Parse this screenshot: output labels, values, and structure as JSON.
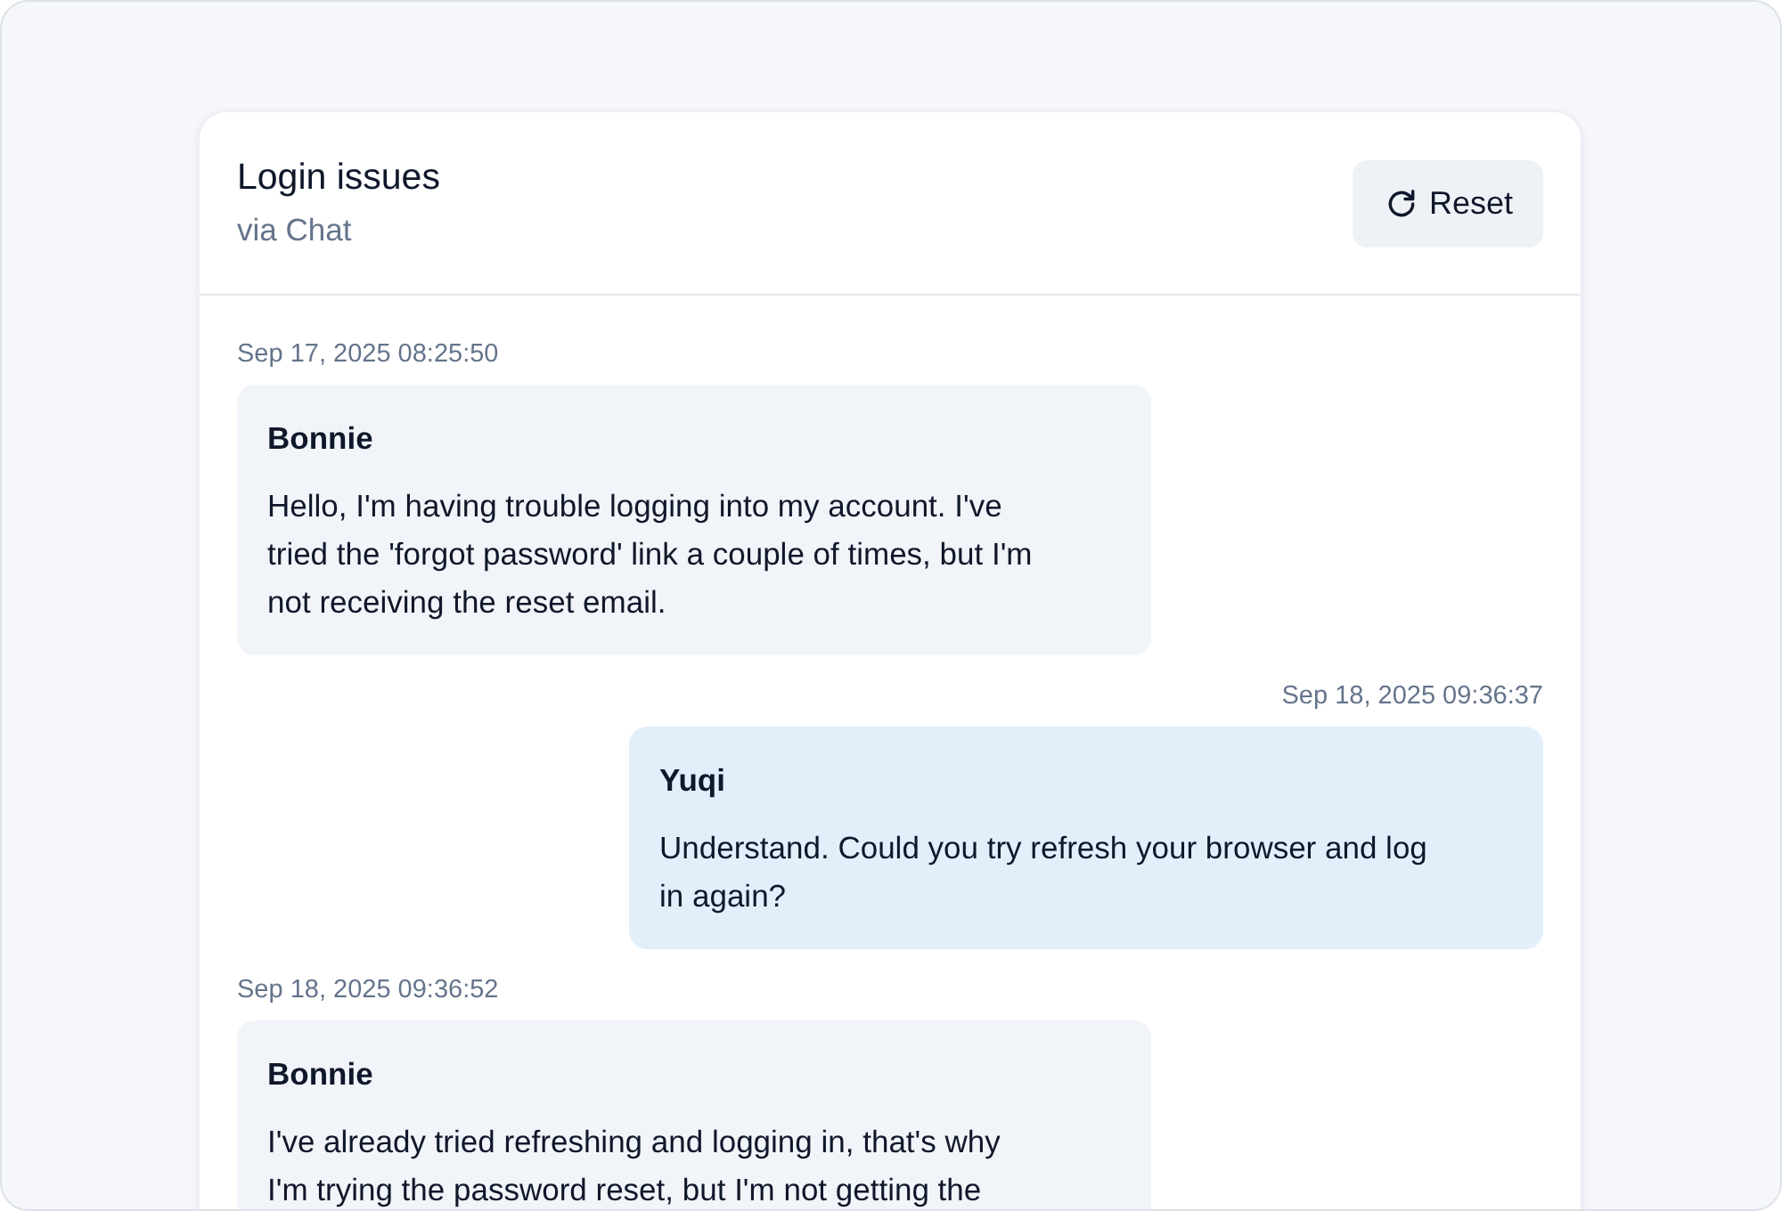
{
  "conversation": {
    "title": "Login issues",
    "channel": "via Chat"
  },
  "reset_button": {
    "label": "Reset"
  },
  "messages": [
    {
      "timestamp": "Sep 17, 2025 08:25:50",
      "sender": "Bonnie",
      "kind": "incoming",
      "text": "Hello, I'm having trouble logging into my account. I've tried the 'forgot password' link a couple of times, but I'm not receiving the reset email."
    },
    {
      "timestamp": "Sep 18, 2025 09:36:37",
      "sender": "Yuqi",
      "kind": "outgoing",
      "text": "Understand. Could you try refresh your browser and log in again?"
    },
    {
      "timestamp": "Sep 18, 2025 09:36:52",
      "sender": "Bonnie",
      "kind": "incoming",
      "text": "I've already tried refreshing and logging in, that's why I'm trying the password reset, but I'm not getting the"
    }
  ]
}
